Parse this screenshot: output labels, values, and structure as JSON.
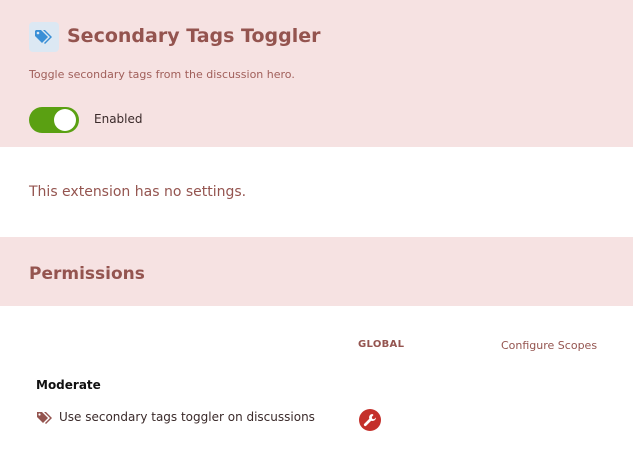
{
  "extension": {
    "title": "Secondary Tags Toggler",
    "description": "Toggle secondary tags from the discussion hero.",
    "icon": "tags-icon",
    "icon_color": "#3a8fd6",
    "icon_bg": "#dce8f3",
    "enabled": true,
    "toggle_label": "Enabled"
  },
  "settings": {
    "message": "This extension has no settings."
  },
  "permissions": {
    "title": "Permissions",
    "columns": {
      "global": "GLOBAL",
      "configure_scopes": "Configure Scopes"
    },
    "groups": [
      {
        "title": "Moderate",
        "items": [
          {
            "label": "Use secondary tags toggler on discussions",
            "icon": "tags-icon",
            "global_icon": "wrench-icon"
          }
        ]
      }
    ]
  },
  "colors": {
    "band_bg": "#f6e2e2",
    "accent_text": "#94544f",
    "toggle_on": "#5aa012",
    "badge_red": "#c4302b"
  }
}
